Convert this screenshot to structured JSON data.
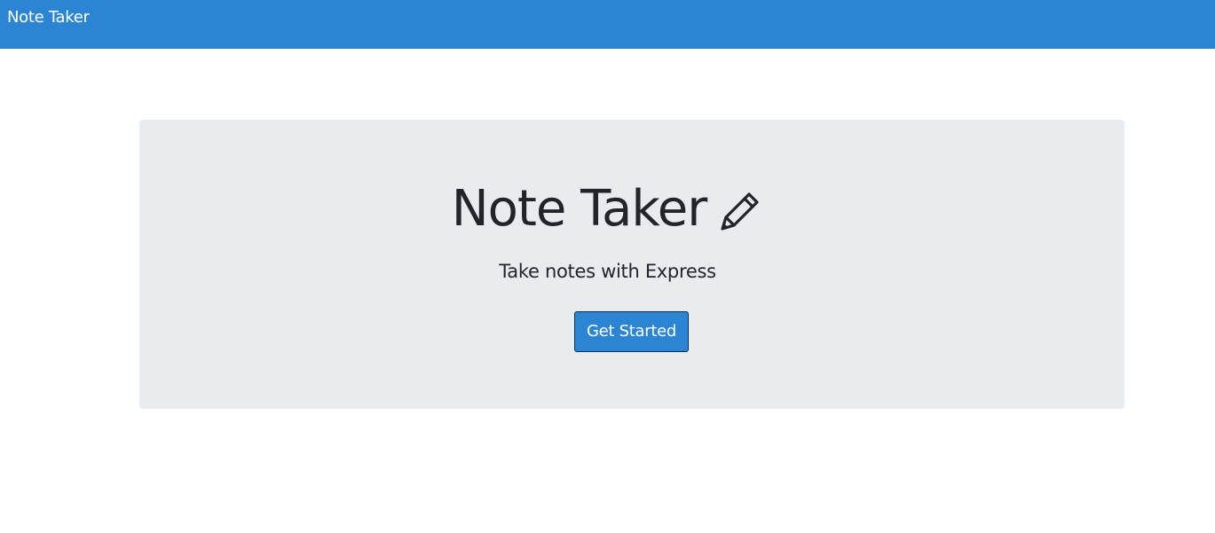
{
  "navbar": {
    "brand": "Note Taker"
  },
  "hero": {
    "title": "Note Taker",
    "title_icon": "pencil-icon",
    "subtitle": "Take notes with Express",
    "button_label": "Get Started"
  },
  "colors": {
    "navbar_bg": "#2b85d2",
    "jumbotron_bg": "#e9ecef",
    "button_bg": "#2b85d2",
    "text": "#212529"
  }
}
